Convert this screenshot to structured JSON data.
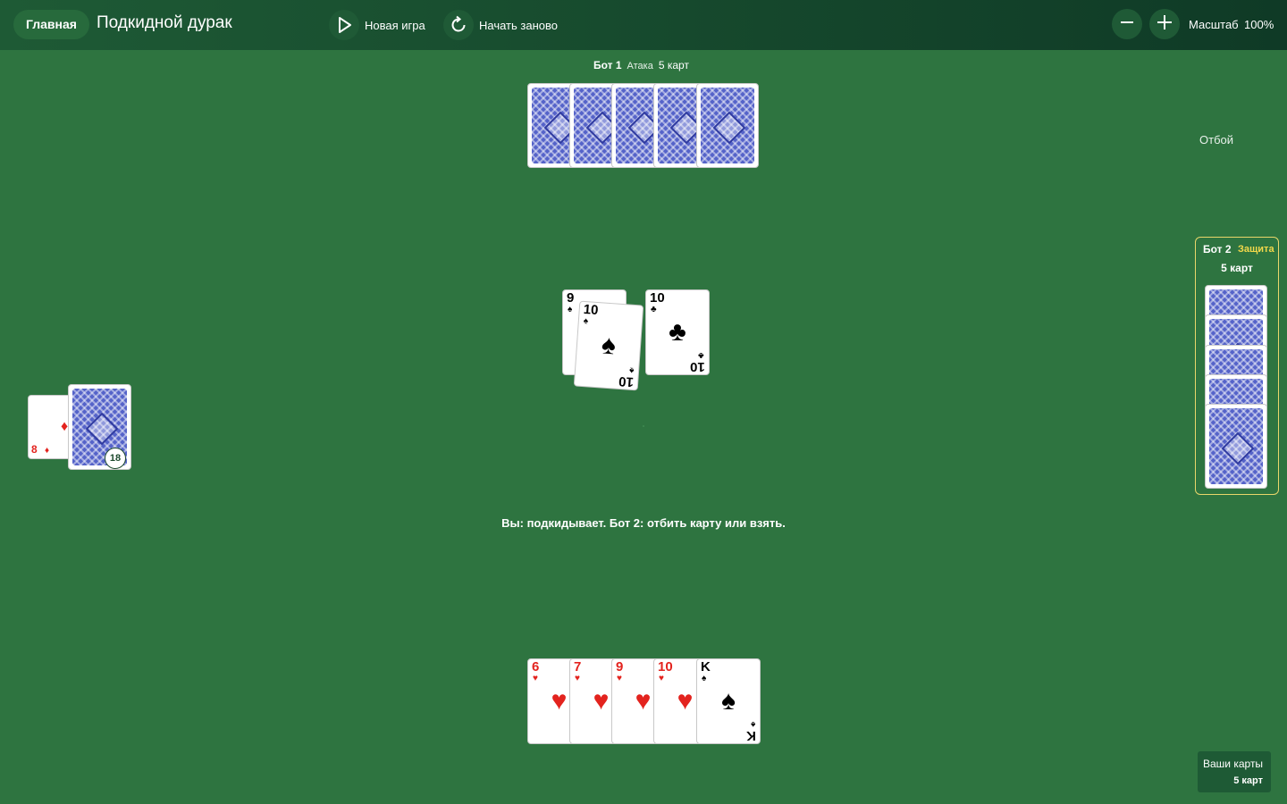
{
  "header": {
    "home_label": "Главная",
    "title": "Подкидной дурак",
    "new_game_label": "Новая игра",
    "restart_label": "Начать заново",
    "zoom_label": "Масштаб",
    "zoom_value": "100%"
  },
  "bot1": {
    "name": "Бот 1",
    "role": "Атака",
    "count": "5 карт"
  },
  "bot2": {
    "name": "Бот 2",
    "role": "Защита",
    "count": "5 карт"
  },
  "discard_label": "Отбой",
  "deck": {
    "count": "18",
    "trump": {
      "rank": "8",
      "suit": "♦"
    }
  },
  "table": [
    {
      "rank": "9",
      "suit": "♠"
    },
    {
      "rank": "10",
      "suit": "♠"
    },
    {
      "rank": "10",
      "suit": "♣"
    }
  ],
  "hand": [
    {
      "rank": "6",
      "suit": "♥"
    },
    {
      "rank": "7",
      "suit": "♥"
    },
    {
      "rank": "9",
      "suit": "♥"
    },
    {
      "rank": "10",
      "suit": "♥"
    },
    {
      "rank": "K",
      "suit": "♠"
    }
  ],
  "status": "Вы: подкидывает. Бот 2: отбить карту или взять.",
  "your_cards": {
    "label": "Ваши карты",
    "count": "5 карт"
  },
  "colors": {
    "table": "#2e7440",
    "header": "#0f3a26",
    "highlight": "#e9d66b",
    "red": "#e3231e"
  }
}
